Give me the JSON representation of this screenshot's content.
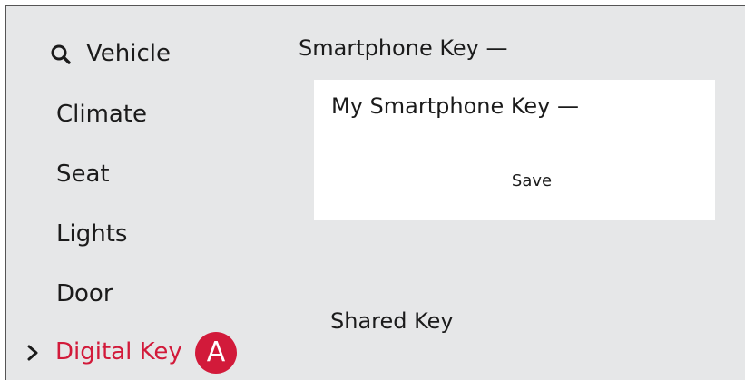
{
  "sidebar": {
    "items": [
      {
        "label": "Vehicle",
        "icon": "search-icon"
      },
      {
        "label": "Climate"
      },
      {
        "label": "Seat"
      },
      {
        "label": "Lights"
      },
      {
        "label": "Door"
      },
      {
        "label": "Digital Key",
        "icon": "chevron-right-icon",
        "active": true
      }
    ],
    "callout_badge": "A"
  },
  "main": {
    "smartphone_key_title": "Smartphone Key —",
    "my_smartphone_key": {
      "title": "My Smartphone Key —",
      "save_label": "Save"
    },
    "shared_key_title": "Shared Key"
  },
  "colors": {
    "background": "#e6e7e8",
    "card": "#ffffff",
    "accent": "#d21a3a",
    "text": "#1b1b1b"
  }
}
